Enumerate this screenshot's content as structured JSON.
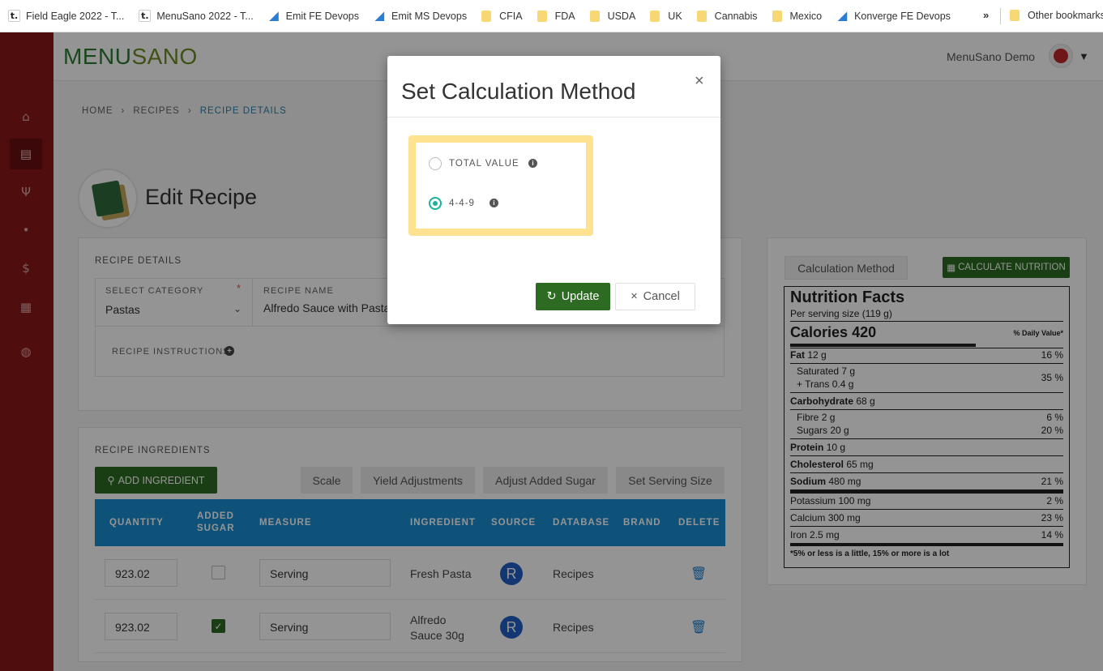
{
  "bookmarks": {
    "items": [
      {
        "label": "Field Eagle 2022 - T...",
        "icon": "t-logo-icon"
      },
      {
        "label": "MenuSano 2022 - T...",
        "icon": "t-logo-icon"
      },
      {
        "label": "Emit FE Devops",
        "icon": "azure-devops-icon"
      },
      {
        "label": "Emit MS Devops",
        "icon": "azure-devops-icon"
      },
      {
        "label": "CFIA",
        "icon": "folder-icon"
      },
      {
        "label": "FDA",
        "icon": "folder-icon"
      },
      {
        "label": "USDA",
        "icon": "folder-icon"
      },
      {
        "label": "UK",
        "icon": "folder-icon"
      },
      {
        "label": "Cannabis",
        "icon": "folder-icon"
      },
      {
        "label": "Mexico",
        "icon": "folder-icon"
      },
      {
        "label": "Konverge FE Devops",
        "icon": "azure-devops-icon"
      }
    ],
    "more": "»",
    "other": "Other bookmarks"
  },
  "header": {
    "logo_menu": "MENU",
    "logo_sano": "SANO",
    "user": "MenuSano Demo"
  },
  "rail": [
    "home-icon",
    "book-icon",
    "utensils-icon",
    "pin-icon",
    "dollar-icon",
    "calculator-icon",
    "globe-icon"
  ],
  "breadcrumb": {
    "home": "HOME",
    "recipes": "RECIPES",
    "current": "RECIPE DETAILS",
    "sep": "›"
  },
  "page": {
    "title": "Edit Recipe"
  },
  "details": {
    "section_label": "RECIPE DETAILS",
    "category_label": "SELECT CATEGORY",
    "category_value": "Pastas",
    "name_label": "RECIPE NAME",
    "name_value": "Alfredo Sauce with Pasta",
    "instructions_label": "RECIPE INSTRUCTIONS"
  },
  "ingredients": {
    "section_label": "RECIPE INGREDIENTS",
    "add_label": "ADD INGREDIENT",
    "buttons": {
      "scale": "Scale",
      "yield": "Yield Adjustments",
      "sugar": "Adjust Added Sugar",
      "serving": "Set Serving Size"
    },
    "headers": {
      "quantity": "QUANTITY",
      "added_sugar_1": "ADDED",
      "added_sugar_2": "SUGAR",
      "measure": "MEASURE",
      "ingredient": "INGREDIENT",
      "source": "SOURCE",
      "database": "DATABASE",
      "brand": "BRAND",
      "delete": "DELETE"
    },
    "rows": [
      {
        "quantity": "923.02",
        "added_sugar": false,
        "measure": "Serving",
        "ingredient_1": "Fresh Pasta",
        "ingredient_2": "",
        "source": "R",
        "database": "Recipes"
      },
      {
        "quantity": "923.02",
        "added_sugar": true,
        "measure": "Serving",
        "ingredient_1": "Alfredo",
        "ingredient_2": "Sauce 30g",
        "source": "R",
        "database": "Recipes"
      }
    ]
  },
  "nutrition": {
    "calc_tab": "Calculation Method",
    "calc_button": "CALCULATE NUTRITION",
    "title": "Nutrition Facts",
    "serving": "Per serving size (119 g)",
    "calories_label": "Calories",
    "calories_value": "420",
    "dv_header": "% Daily Value*",
    "rows": {
      "fat": {
        "label": "Fat",
        "value": "12 g",
        "pct": "16 %"
      },
      "saturated": {
        "label": "Saturated",
        "value": "7 g"
      },
      "trans": {
        "label": "+ Trans",
        "value": "0.4 g",
        "pct": "35 %"
      },
      "carb": {
        "label": "Carbohydrate",
        "value": "68 g"
      },
      "fibre": {
        "label": "Fibre",
        "value": "2 g",
        "pct": "6 %"
      },
      "sugars": {
        "label": "Sugars",
        "value": "20 g",
        "pct": "20 %"
      },
      "protein": {
        "label": "Protein",
        "value": "10 g"
      },
      "cholesterol": {
        "label": "Cholesterol",
        "value": "65 mg"
      },
      "sodium": {
        "label": "Sodium",
        "value": "480 mg",
        "pct": "21 %"
      },
      "potassium": {
        "label": "Potassium",
        "value": "100 mg",
        "pct": "2 %"
      },
      "calcium": {
        "label": "Calcium",
        "value": "300 mg",
        "pct": "23 %"
      },
      "iron": {
        "label": "Iron",
        "value": "2.5 mg",
        "pct": "14 %"
      }
    },
    "footnote": "*5% or less is a little, 15% or more is a lot"
  },
  "modal": {
    "title": "Set Calculation Method",
    "close": "×",
    "options": [
      {
        "label": "TOTAL VALUE",
        "selected": false
      },
      {
        "label": "4-4-9",
        "selected": true
      }
    ],
    "info_glyph": "i",
    "update_label": "Update",
    "cancel_label": "Cancel"
  },
  "colors": {
    "brand_green": "#2e6b22",
    "rail_red": "#8b1719",
    "table_blue": "#1b8dd1",
    "radio_teal": "#1ab39a",
    "highlight": "#ffe08a"
  }
}
